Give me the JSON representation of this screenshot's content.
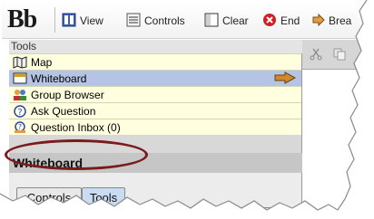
{
  "toolbar": {
    "logo": "Bb",
    "view_label": "View",
    "controls_label": "Controls",
    "clear_label": "Clear",
    "end_label": "End",
    "break_label": "Brea"
  },
  "tools": {
    "header": "Tools",
    "items": [
      {
        "label": "Map",
        "icon": "map-icon"
      },
      {
        "label": "Whiteboard",
        "icon": "whiteboard-icon",
        "selected": true
      },
      {
        "label": "Group Browser",
        "icon": "group-browser-icon"
      },
      {
        "label": "Ask Question",
        "icon": "question-icon"
      },
      {
        "label": "Question Inbox (0)",
        "icon": "question-inbox-icon"
      }
    ]
  },
  "whiteboard": {
    "header": "Whiteboard",
    "tabs": [
      {
        "label": "Controls"
      },
      {
        "label": "Tools",
        "active": true
      }
    ]
  },
  "colors": {
    "tool_row_bg": "#ffffe0",
    "selected_row_bg": "#b5c4e4",
    "highlight_oval": "#7a1a1a",
    "arrow": "#d08a2a"
  }
}
